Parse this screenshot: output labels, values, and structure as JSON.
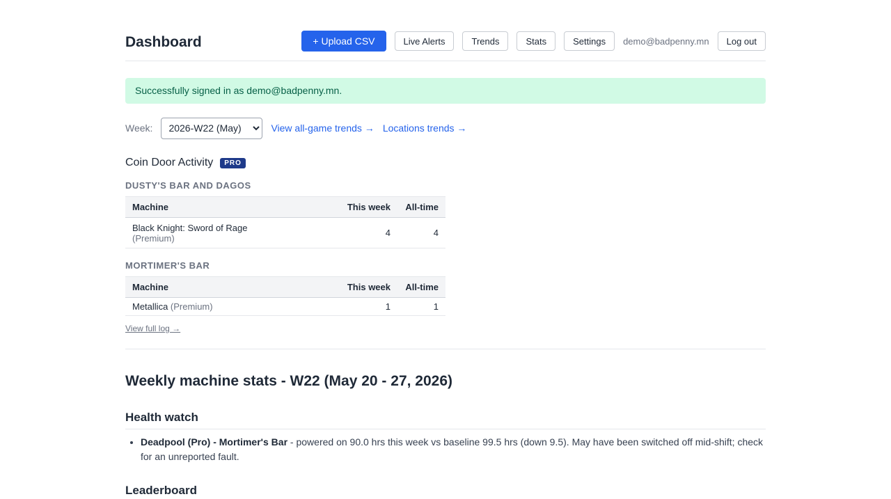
{
  "header": {
    "title": "Dashboard",
    "upload_label": "+ Upload CSV",
    "nav": [
      "Live Alerts",
      "Trends",
      "Stats",
      "Settings"
    ],
    "user_email": "demo@badpenny.mn",
    "logout_label": "Log out"
  },
  "flash": {
    "message": "Successfully signed in as demo@badpenny.mn."
  },
  "week": {
    "label": "Week:",
    "selected": "2026-W22 (May)",
    "links": [
      "View all-game trends →",
      "Locations trends →"
    ]
  },
  "coin_door": {
    "title": "Coin Door Activity",
    "badge": "PRO",
    "columns": [
      "Machine",
      "This week",
      "All-time"
    ],
    "locations": [
      {
        "name": "DUSTY'S BAR AND DAGOS",
        "rows": [
          {
            "machine": "Black Knight: Sword of Rage",
            "variant": "(Premium)",
            "this_week": "4",
            "all_time": "4"
          }
        ]
      },
      {
        "name": "MORTIMER'S BAR",
        "rows": [
          {
            "machine": "Metallica",
            "variant": "(Premium)",
            "this_week": "1",
            "all_time": "1"
          }
        ]
      }
    ],
    "view_log": "View full log →"
  },
  "weekly": {
    "title": "Weekly machine stats - W22 (May 20 - 27, 2026)",
    "health_title": "Health watch",
    "health_items": [
      {
        "machine": "Deadpool (Pro) - Mortimer's Bar",
        "text": " - powered on 90.0 hrs this week vs baseline 99.5 hrs (down 9.5). May have been switched off mid-shift; check for an unreported fault."
      }
    ],
    "leaderboard_title": "Leaderboard"
  },
  "colors": {
    "primary": "#2563eb",
    "flash_bg": "#d1fae5",
    "flash_text": "#065f46",
    "badge_bg": "#1e3a8a"
  },
  "icons": {
    "arrow_right": "→"
  }
}
